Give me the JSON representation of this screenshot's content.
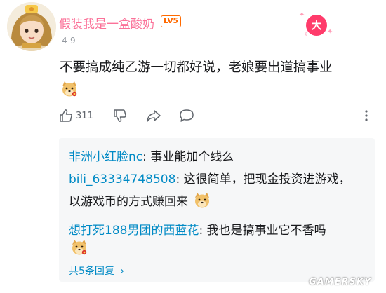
{
  "comment": {
    "username": "假装我是一盒酸奶",
    "level": "LV5",
    "date": "4-9",
    "text": "不要搞成纯乙游一切都好说，老娘要出道搞事业",
    "deco_badge": "大",
    "like_count": "311"
  },
  "actions": {
    "like_icon": "thumbs-up-icon",
    "dislike_icon": "thumbs-down-icon",
    "share_icon": "share-icon",
    "reply_icon": "comment-bubble-icon"
  },
  "replies": [
    {
      "user": "非洲小红脸nc",
      "separator": ":",
      "text": " 事业能加个线么"
    },
    {
      "user": "bili_63334748508",
      "separator": ":",
      "text": " 这很简单，把现金投资进游戏，",
      "text2": "以游戏币的方式赚回来"
    },
    {
      "user": "想打死188男团的西蓝花",
      "separator": ":",
      "text": " 我也是搞事业它不香吗"
    }
  ],
  "more_replies_label": "共5条回复",
  "more_replies_chevron": "›",
  "watermark": "GAMERSKY",
  "colors": {
    "username": "#fb7299",
    "reply_user": "#008ac5",
    "level_badge": "#ff6a00",
    "meta": "#9499a0",
    "reply_bg": "#f6f7f8"
  }
}
